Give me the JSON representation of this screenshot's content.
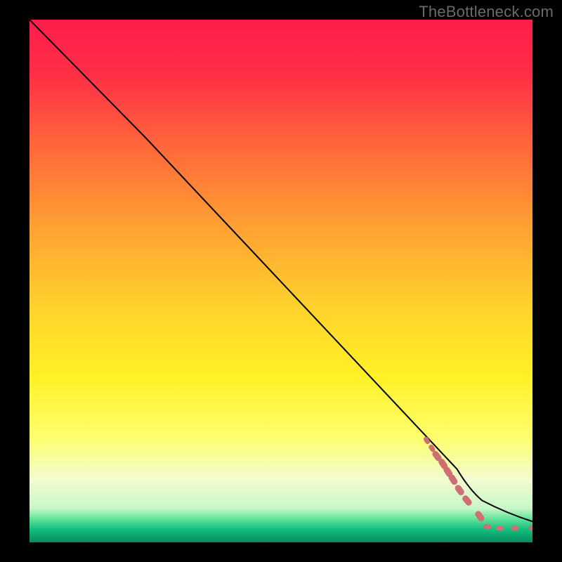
{
  "watermark": "TheBottleneck.com",
  "chart_data": {
    "type": "area",
    "title": "",
    "xlabel": "",
    "ylabel": "",
    "xlim": [
      0,
      100
    ],
    "ylim": [
      0,
      100
    ],
    "gradient_stops": [
      {
        "offset": 0.0,
        "color": "#ff1e4b"
      },
      {
        "offset": 0.1,
        "color": "#ff2d47"
      },
      {
        "offset": 0.25,
        "color": "#ff6a3a"
      },
      {
        "offset": 0.4,
        "color": "#ffa232"
      },
      {
        "offset": 0.55,
        "color": "#ffd22c"
      },
      {
        "offset": 0.68,
        "color": "#fff126"
      },
      {
        "offset": 0.8,
        "color": "#fdfe6e"
      },
      {
        "offset": 0.88,
        "color": "#f2fcd0"
      },
      {
        "offset": 0.935,
        "color": "#c8f7c8"
      },
      {
        "offset": 0.955,
        "color": "#63e29a"
      },
      {
        "offset": 0.975,
        "color": "#11c07e"
      },
      {
        "offset": 1.0,
        "color": "#0a8a5f"
      }
    ],
    "series": [
      {
        "name": "black-curve",
        "color": "#000000",
        "stroke_width": 2,
        "points": [
          {
            "x": 0.0,
            "y": 100.0
          },
          {
            "x": 23.0,
            "y": 77.5
          },
          {
            "x": 85.0,
            "y": 14.0
          },
          {
            "x": 90.0,
            "y": 8.0
          },
          {
            "x": 100.0,
            "y": 4.0
          }
        ]
      },
      {
        "name": "red-dotted-tail",
        "color": "#cf6e74",
        "points": [
          {
            "x": 79.0,
            "y": 19.5
          },
          {
            "x": 80.0,
            "y": 18.0
          },
          {
            "x": 81.0,
            "y": 16.5
          },
          {
            "x": 82.2,
            "y": 15.0
          },
          {
            "x": 83.2,
            "y": 13.5
          },
          {
            "x": 84.2,
            "y": 12.0
          },
          {
            "x": 85.5,
            "y": 10.0
          },
          {
            "x": 87.0,
            "y": 8.0
          },
          {
            "x": 89.5,
            "y": 5.0
          },
          {
            "x": 91.0,
            "y": 3.0
          },
          {
            "x": 93.5,
            "y": 2.7
          },
          {
            "x": 96.5,
            "y": 2.7
          },
          {
            "x": 100.0,
            "y": 2.7
          }
        ]
      }
    ]
  }
}
